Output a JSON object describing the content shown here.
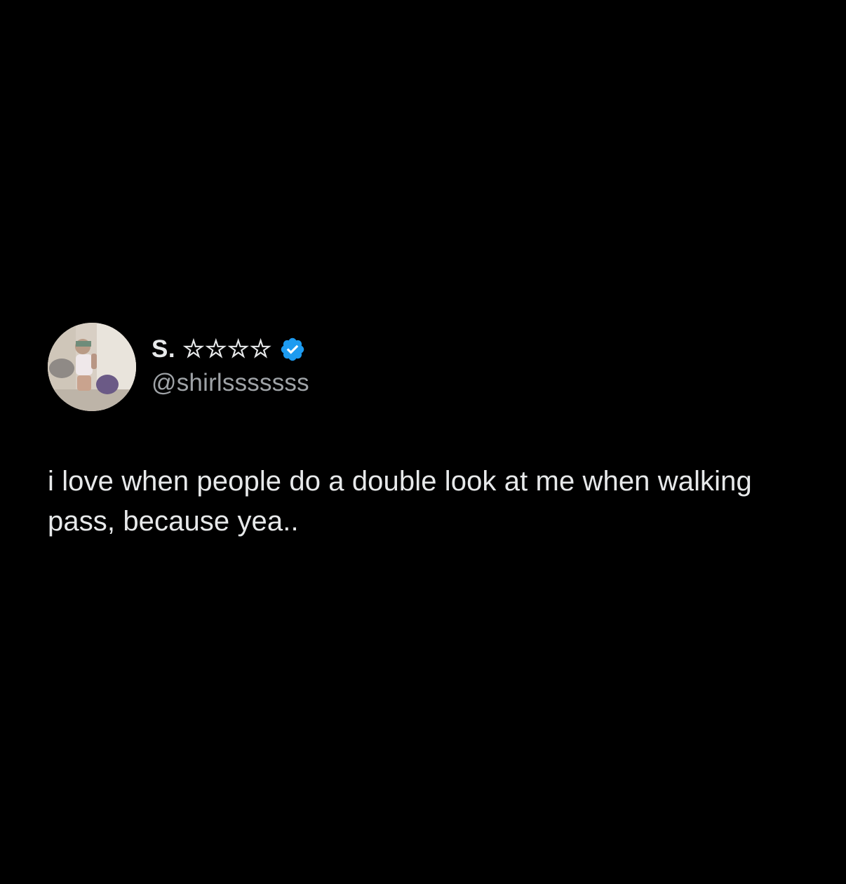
{
  "tweet": {
    "author": {
      "display_name": "S. ☆☆☆☆",
      "handle": "@shirlsssssss",
      "verified_icon": "verified-badge-icon",
      "avatar_icon": "profile-photo-avatar"
    },
    "text": "i love when people do a double look at me when walking pass, because yea.."
  },
  "colors": {
    "background": "#000000",
    "text_primary": "#e7e9ea",
    "text_secondary": "#9fa3a7",
    "verified_blue": "#1d9bf0"
  }
}
